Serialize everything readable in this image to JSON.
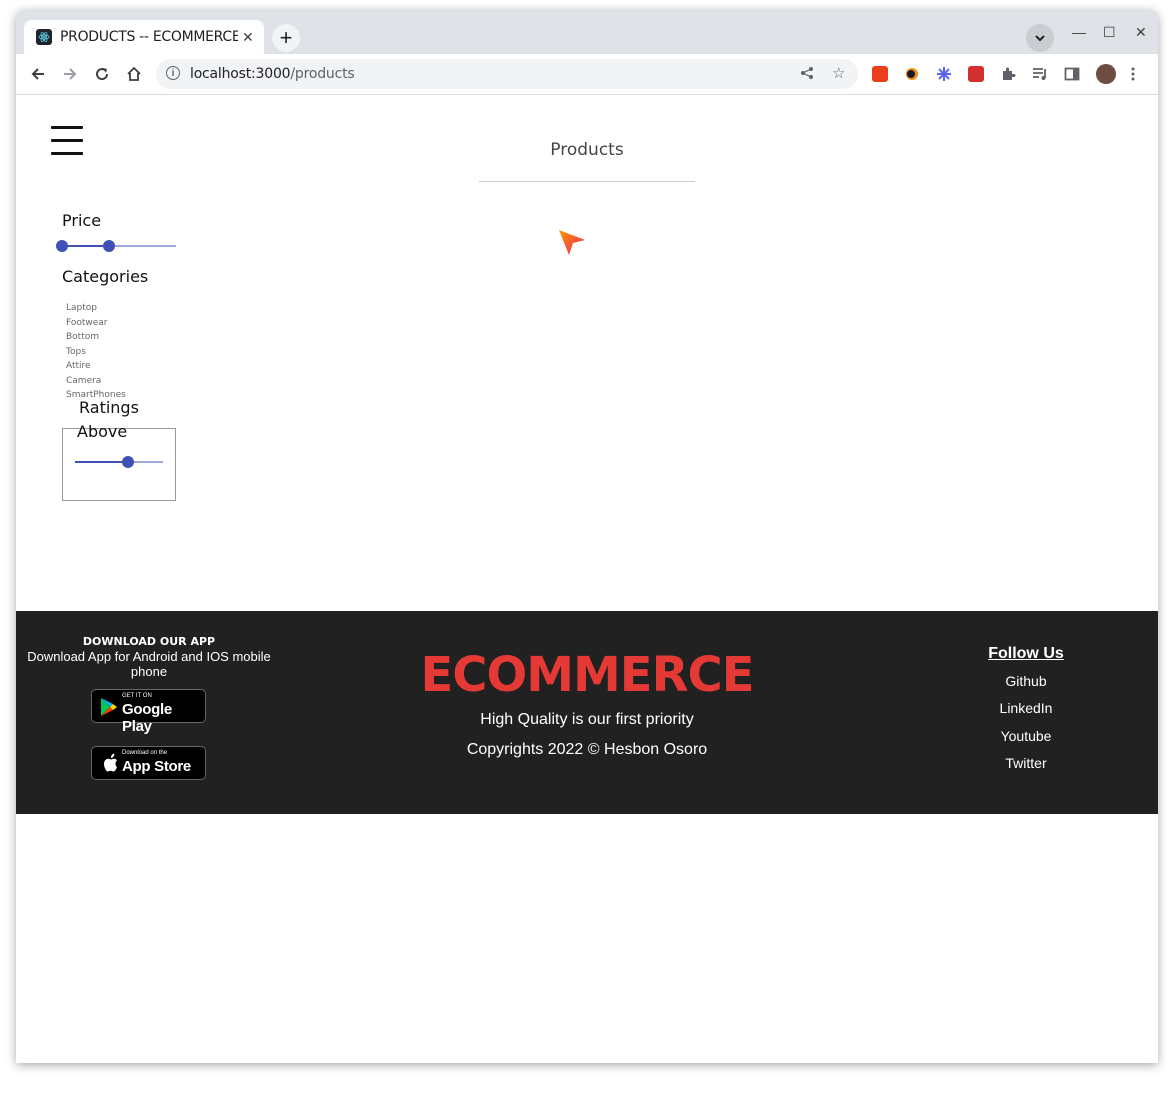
{
  "browser": {
    "tab_title": "PRODUCTS -- ECOMMERCE",
    "tab_close": "✕",
    "new_tab": "+",
    "url_host": "localhost:3000",
    "url_path": "/products",
    "window_controls": {
      "minimize": "—",
      "maximize": "☐",
      "close": "✕"
    }
  },
  "page": {
    "heading": "Products",
    "filters": {
      "price_title": "Price",
      "price_range": [
        0,
        25000
      ],
      "categories_title": "Categories",
      "categories": [
        "Laptop",
        "Footwear",
        "Bottom",
        "Tops",
        "Attire",
        "Camera",
        "SmartPhones"
      ],
      "ratings_legend": "Ratings",
      "ratings_label": "Above",
      "ratings_value_fraction": 0.6
    }
  },
  "footer": {
    "download_title": "DOWNLOAD OUR APP",
    "download_desc": "Download App for Android and IOS mobile phone",
    "google_play_small": "GET IT ON",
    "google_play_big": "Google Play",
    "app_store_small": "Download on the",
    "app_store_big": "App Store",
    "brand": "ECOMMERCE",
    "tagline": "High Quality is our first priority",
    "copyright": "Copyrights 2022 © Hesbon Osoro",
    "follow_title": "Follow Us",
    "social_links": [
      "Github",
      "LinkedIn",
      "Youtube",
      "Twitter"
    ]
  },
  "colors": {
    "brand_red": "#e53935",
    "footer_bg": "#212121",
    "slider_primary": "#3f51b5",
    "slider_track": "#9fa8da"
  }
}
